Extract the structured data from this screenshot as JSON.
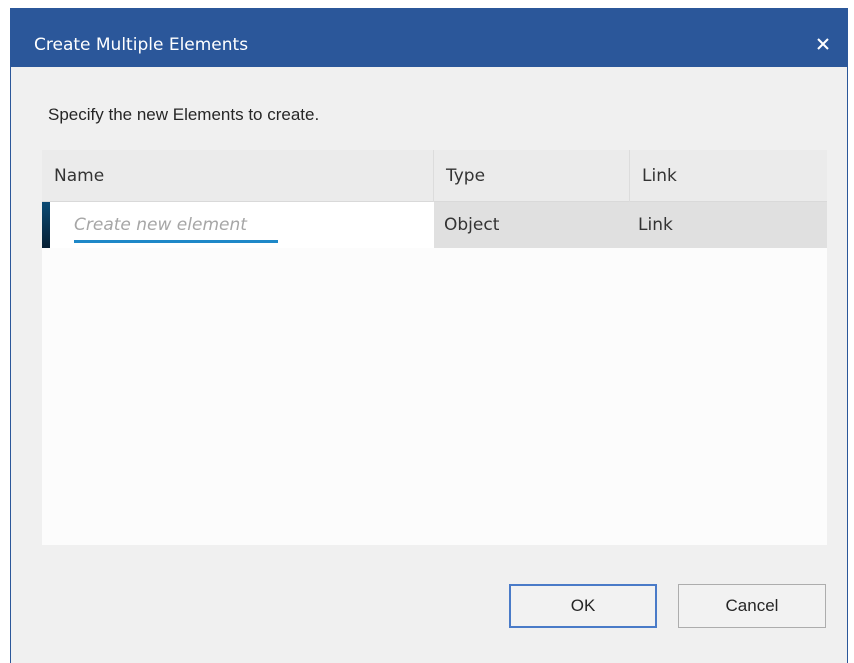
{
  "dialog": {
    "title": "Create Multiple Elements",
    "close_icon": "close-icon",
    "instruction": "Specify the new Elements to create."
  },
  "grid": {
    "columns": [
      "Name",
      "Type",
      "Link"
    ],
    "rows": [
      {
        "name_placeholder": "Create new element",
        "name_value": "",
        "type": "Object",
        "link": "Link"
      }
    ]
  },
  "buttons": {
    "ok": "OK",
    "cancel": "Cancel"
  },
  "colors": {
    "titlebar": "#2b579a",
    "accent_underline": "#1e88c8",
    "ok_border": "#4a7bc8"
  }
}
